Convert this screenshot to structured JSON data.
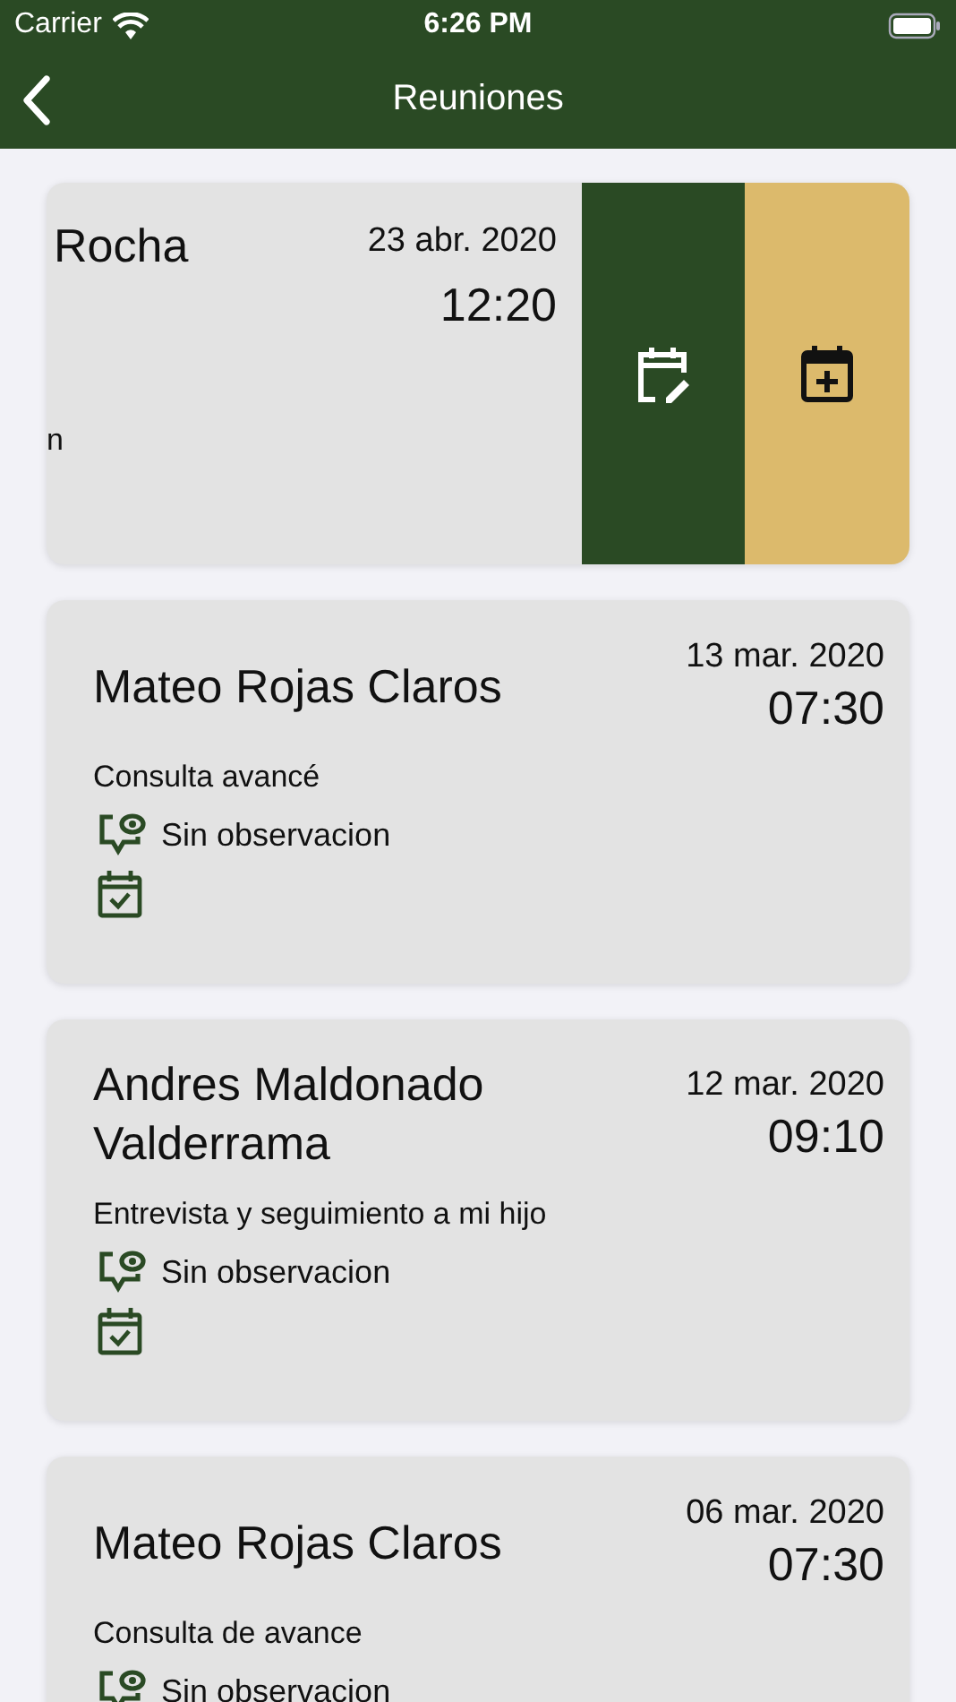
{
  "status_bar": {
    "carrier": "Carrier",
    "time": "6:26 PM"
  },
  "nav": {
    "title": "Reuniones"
  },
  "meetings": [
    {
      "kind": "swiped",
      "name": "Rocha",
      "date": "23 abr. 2020",
      "time": "12:20",
      "fragment": "n"
    },
    {
      "kind": "normal",
      "name": "Mateo Rojas Claros",
      "date": "13 mar. 2020",
      "time": "07:30",
      "subject": "Consulta avancé",
      "observation": "Sin observacion",
      "calendar_confirmed": true
    },
    {
      "kind": "normal",
      "name": "Andres Maldonado Valderrama",
      "date": "12 mar. 2020",
      "time": "09:10",
      "subject": "Entrevista y seguimiento a mi hijo",
      "observation": "Sin observacion",
      "calendar_confirmed": true
    },
    {
      "kind": "normal",
      "name": "Mateo Rojas Claros",
      "date": "06 mar. 2020",
      "time": "07:30",
      "subject": "Consulta de avance",
      "observation": "Sin observacion"
    }
  ]
}
